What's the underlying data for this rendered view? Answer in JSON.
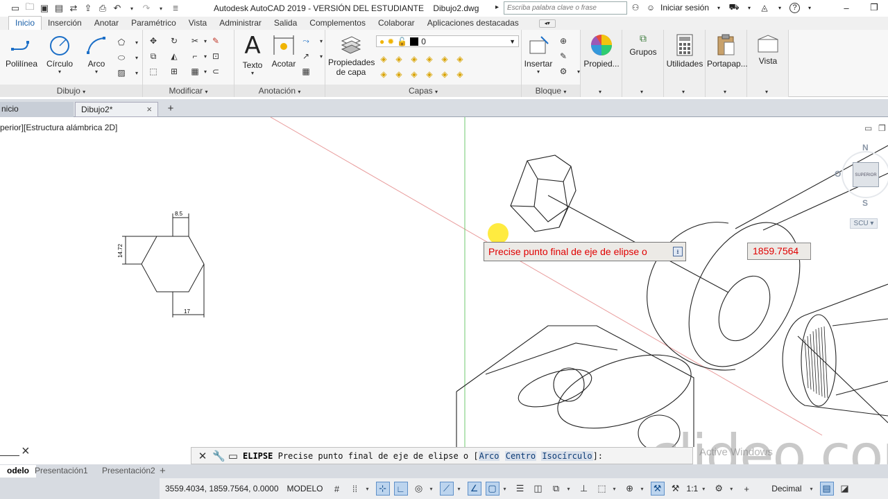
{
  "window": {
    "title": "Autodesk AutoCAD 2019 - VERSIÓN DEL ESTUDIANTE    Dibujo2.dwg",
    "search_placeholder": "Escriba palabra clave o frase",
    "signin_label": "Iniciar sesión"
  },
  "ribbon": {
    "tabs": [
      "Inicio",
      "Inserción",
      "Anotar",
      "Paramétrico",
      "Vista",
      "Administrar",
      "Salida",
      "Complementos",
      "Colaborar",
      "Aplicaciones destacadas"
    ],
    "active_tab": "Inicio",
    "dibujo": {
      "polilinea": "Polilínea",
      "circulo": "Círculo",
      "arco": "Arco",
      "title": "Dibujo"
    },
    "modificar": {
      "title": "Modificar"
    },
    "anotacion": {
      "texto": "Texto",
      "acotar": "Acotar",
      "title": "Anotación"
    },
    "capas": {
      "propiedades_1": "Propiedades",
      "propiedades_2": "de capa",
      "layer_value": "0",
      "title": "Capas"
    },
    "bloque": {
      "insertar": "Insertar",
      "title": "Bloque"
    },
    "propiedades": {
      "label": "Propied..."
    },
    "grupos": {
      "label": "Grupos"
    },
    "utilidades": {
      "label": "Utilidades"
    },
    "portapapeles": {
      "label": "Portapap..."
    },
    "vista": {
      "label": "Vista"
    }
  },
  "file_tabs": [
    {
      "label": "nicio"
    },
    {
      "label": "Dibujo2*"
    }
  ],
  "viewport": {
    "label": "perior][Estructura alámbrica 2D]",
    "dimensions": {
      "top": "8.5",
      "side": "14.72",
      "bottom": "17"
    },
    "viewcube": {
      "north": "N",
      "south": "S",
      "west": "O",
      "face": "SUPERIOR",
      "ucs": "SCU"
    }
  },
  "dynamic_input": {
    "prompt": "Precise punto final de eje de elipse o",
    "value": "1859.7564"
  },
  "command_line": {
    "command": "ELIPSE",
    "prompt": "Precise punto final de eje de elipse o [",
    "options": [
      "Arco",
      "Centro",
      "Isocírculo"
    ],
    "suffix": "]:"
  },
  "layout_tabs": [
    {
      "label": "odelo",
      "active": true
    },
    {
      "label": "Presentación1",
      "active": false
    },
    {
      "label": "Presentación2",
      "active": false
    }
  ],
  "status_bar": {
    "coordinates": "3559.4034, 1859.7564, 0.0000",
    "space": "MODELO",
    "scale": "1:1",
    "units": "Decimal"
  },
  "overlay": {
    "watermark": "clideo.com",
    "activate_text": "Active Windows"
  },
  "colors": {
    "tooltip_text": "#e00000",
    "active_tab": "#1a5fa8",
    "status_on": "#bcd4ee"
  }
}
